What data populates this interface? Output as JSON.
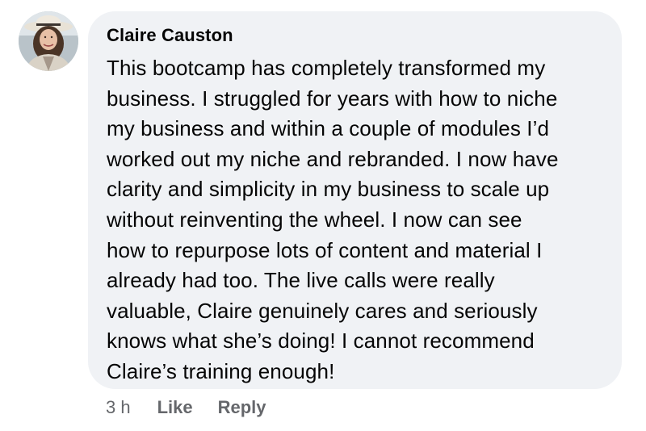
{
  "comment": {
    "author": "Claire Causton",
    "text": "This bootcamp has completely transformed my\nbusiness. I struggled for years with how to niche\nmy business and within a couple of modules I’d\nworked out my niche and rebranded. I now have\nclarity and simplicity in my business to scale up\nwithout reinventing the wheel.  I now can see\nhow to repurpose lots of content and material I\nalready had too. The live calls were really\nvaluable, Claire genuinely cares and seriously\nknows what she’s doing! I cannot recommend\nClaire’s training enough!",
    "avatar_icon": "profile-photo"
  },
  "actions": {
    "timestamp": "3 h",
    "like_label": "Like",
    "reply_label": "Reply"
  },
  "colors": {
    "bubble": "#f0f2f5",
    "text": "#050505",
    "secondary": "#65676b"
  }
}
